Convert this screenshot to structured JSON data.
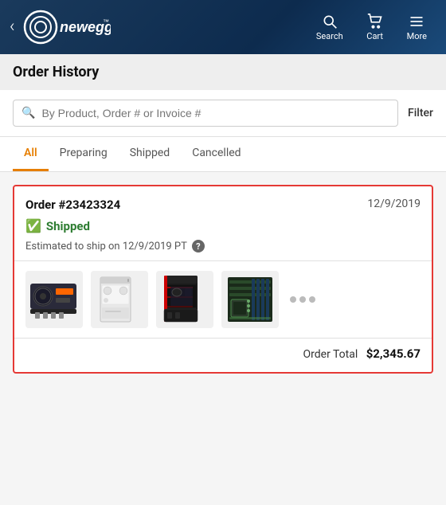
{
  "header": {
    "back_label": "‹",
    "logo_text": "newegg",
    "nav_items": [
      {
        "id": "search",
        "label": "Search"
      },
      {
        "id": "cart",
        "label": "Cart"
      },
      {
        "id": "more",
        "label": "More"
      }
    ]
  },
  "page": {
    "title": "Order History"
  },
  "search_bar": {
    "placeholder": "By Product, Order # or Invoice #",
    "filter_label": "Filter"
  },
  "tabs": [
    {
      "id": "all",
      "label": "All",
      "active": true
    },
    {
      "id": "preparing",
      "label": "Preparing",
      "active": false
    },
    {
      "id": "shipped",
      "label": "Shipped",
      "active": false
    },
    {
      "id": "cancelled",
      "label": "Cancelled",
      "active": false
    }
  ],
  "orders": [
    {
      "order_number": "Order #23423324",
      "date": "12/9/2019",
      "status": "Shipped",
      "estimate_text": "Estimated to ship on 12/9/2019 PT",
      "order_total_label": "Order Total",
      "order_total_amount": "$2,345.67"
    }
  ]
}
